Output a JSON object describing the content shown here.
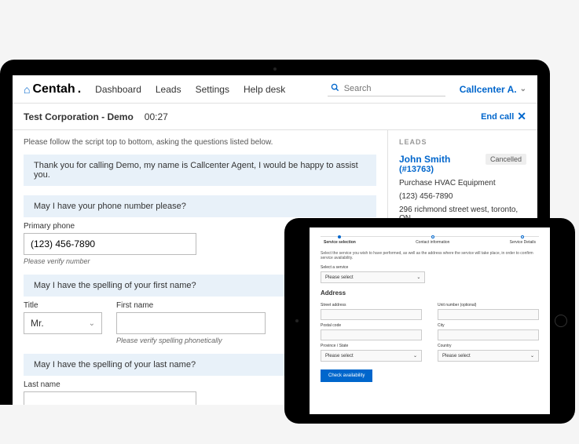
{
  "brand": {
    "name": "Centah",
    "dot": "."
  },
  "nav": [
    "Dashboard",
    "Leads",
    "Settings",
    "Help desk"
  ],
  "search": {
    "placeholder": "Search"
  },
  "user": "Callcenter A.",
  "call": {
    "title": "Test Corporation - Demo",
    "timer": "00:27",
    "end": "End call"
  },
  "instruction": "Please follow the script top to bottom, asking the questions listed below.",
  "script": {
    "greeting": "Thank you for calling Demo, my name is Callcenter Agent, I would be happy to assist you.",
    "phoneQ": "May I have your phone number please?",
    "firstQ": "May I have the spelling of your first name?",
    "lastQ": "May I have the spelling of your last name?"
  },
  "labels": {
    "primaryPhone": "Primary phone",
    "verifyNumber": "Please verify number",
    "title": "Title",
    "firstName": "First name",
    "verifySpelling": "Please verify spelling phonetically",
    "lastName": "Last name"
  },
  "values": {
    "phone": "(123) 456-7890",
    "title": "Mr.",
    "firstName": "",
    "lastName": ""
  },
  "leads": {
    "heading": "LEADS",
    "name": "John Smith",
    "id": "(#13763)",
    "status": "Cancelled",
    "service": "Purchase HVAC Equipment",
    "phone": "(123) 456-7890",
    "address": "296 richmond street west, toronto, ON"
  },
  "tablet": {
    "steps": [
      "Service selection",
      "Contact information",
      "Service Details"
    ],
    "desc": "Select the service you wish to have performed, as well as the address where the service will take place, in order to confirm service availability.",
    "selectService": "Select a service",
    "pleaseSelect": "Please select",
    "address": "Address",
    "street": "Street address",
    "unit": "Unit number (optional)",
    "postal": "Postal code",
    "city": "City",
    "province": "Province / State",
    "country": "Country",
    "check": "Check availability"
  }
}
